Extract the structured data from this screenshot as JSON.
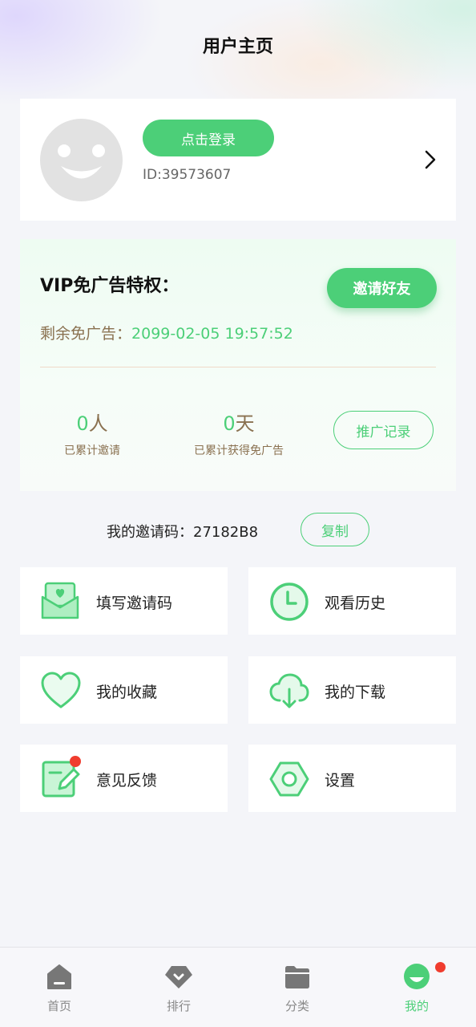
{
  "header": {
    "title": "用户主页"
  },
  "profile": {
    "login_label": "点击登录",
    "user_id": "ID:39573607"
  },
  "vip": {
    "title": "VIP免广告特权：",
    "invite_button": "邀请好友",
    "remaining_label": "剩余免广告：",
    "remaining_value": "2099-02-05 19:57:52",
    "invited_count": "0",
    "invited_unit": "人",
    "invited_label": "已累计邀请",
    "days_count": "0",
    "days_unit": "天",
    "days_label": "已累计获得免广告",
    "promo_button": "推广记录"
  },
  "invite_code": {
    "label": "我的邀请码：",
    "code": "27182B8",
    "copy_button": "复制"
  },
  "menu": [
    {
      "label": "填写邀请码",
      "icon": "envelope-heart-icon",
      "badge": false
    },
    {
      "label": "观看历史",
      "icon": "clock-icon",
      "badge": false
    },
    {
      "label": "我的收藏",
      "icon": "heart-icon",
      "badge": false
    },
    {
      "label": "我的下载",
      "icon": "cloud-download-icon",
      "badge": false
    },
    {
      "label": "意见反馈",
      "icon": "edit-icon",
      "badge": true
    },
    {
      "label": "设置",
      "icon": "hexagon-settings-icon",
      "badge": false
    }
  ],
  "nav": [
    {
      "label": "首页",
      "icon": "home-icon",
      "active": false
    },
    {
      "label": "排行",
      "icon": "ranking-icon",
      "active": false
    },
    {
      "label": "分类",
      "icon": "folder-icon",
      "active": false
    },
    {
      "label": "我的",
      "icon": "profile-icon",
      "active": true,
      "badge": true
    }
  ],
  "colors": {
    "accent": "#4ccf78",
    "brown_text": "#8a7150",
    "badge_red": "#f03c2e",
    "background": "#f4f5f9"
  }
}
